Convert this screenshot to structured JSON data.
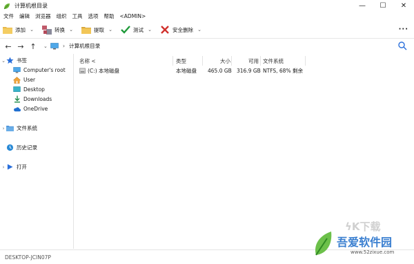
{
  "window": {
    "title": "计算机根目录",
    "minimize": "—",
    "maximize": "☐",
    "close": "✕"
  },
  "menu": [
    "文件",
    "编辑",
    "浏览器",
    "组织",
    "工具",
    "选项",
    "帮助",
    "<ADMIN>"
  ],
  "toolbar": {
    "buttons": [
      {
        "label": "添加",
        "icon": "folder-add-icon"
      },
      {
        "label": "转换",
        "icon": "convert-icon"
      },
      {
        "label": "提取",
        "icon": "extract-icon"
      },
      {
        "label": "测试",
        "icon": "check-icon"
      },
      {
        "label": "安全删除",
        "icon": "delete-icon"
      }
    ],
    "more": "···"
  },
  "address": {
    "path": "计算机根目录",
    "separator": "›"
  },
  "sidebar": {
    "bookmarks_label": "书签",
    "bookmarks": [
      {
        "label": "Computer's root",
        "icon": "computer-icon"
      },
      {
        "label": "User",
        "icon": "home-icon"
      },
      {
        "label": "Desktop",
        "icon": "desktop-icon"
      },
      {
        "label": "Downloads",
        "icon": "download-icon"
      },
      {
        "label": "OneDrive",
        "icon": "cloud-icon"
      }
    ],
    "filesystem_label": "文件系统",
    "history_label": "历史记录",
    "open_label": "打开"
  },
  "table": {
    "headers": {
      "name": "名称 <",
      "type": "类型",
      "size": "大小",
      "free": "可用",
      "fs": "文件系统"
    },
    "rows": [
      {
        "name": "(C:) 本地磁盘",
        "type": "本地磁盘",
        "size": "465.0 GB",
        "free": "316.9 GB",
        "fs": "NTFS, 68% 剩余"
      }
    ]
  },
  "status": {
    "computer": "DESKTOP-JCIN07P"
  },
  "watermark": {
    "text": "吾爱软件园",
    "url": "www.52zixue.com",
    "top": "ϟK下载"
  },
  "colors": {
    "accent": "#2a6fdb",
    "watermark": "#3a7fd0"
  }
}
